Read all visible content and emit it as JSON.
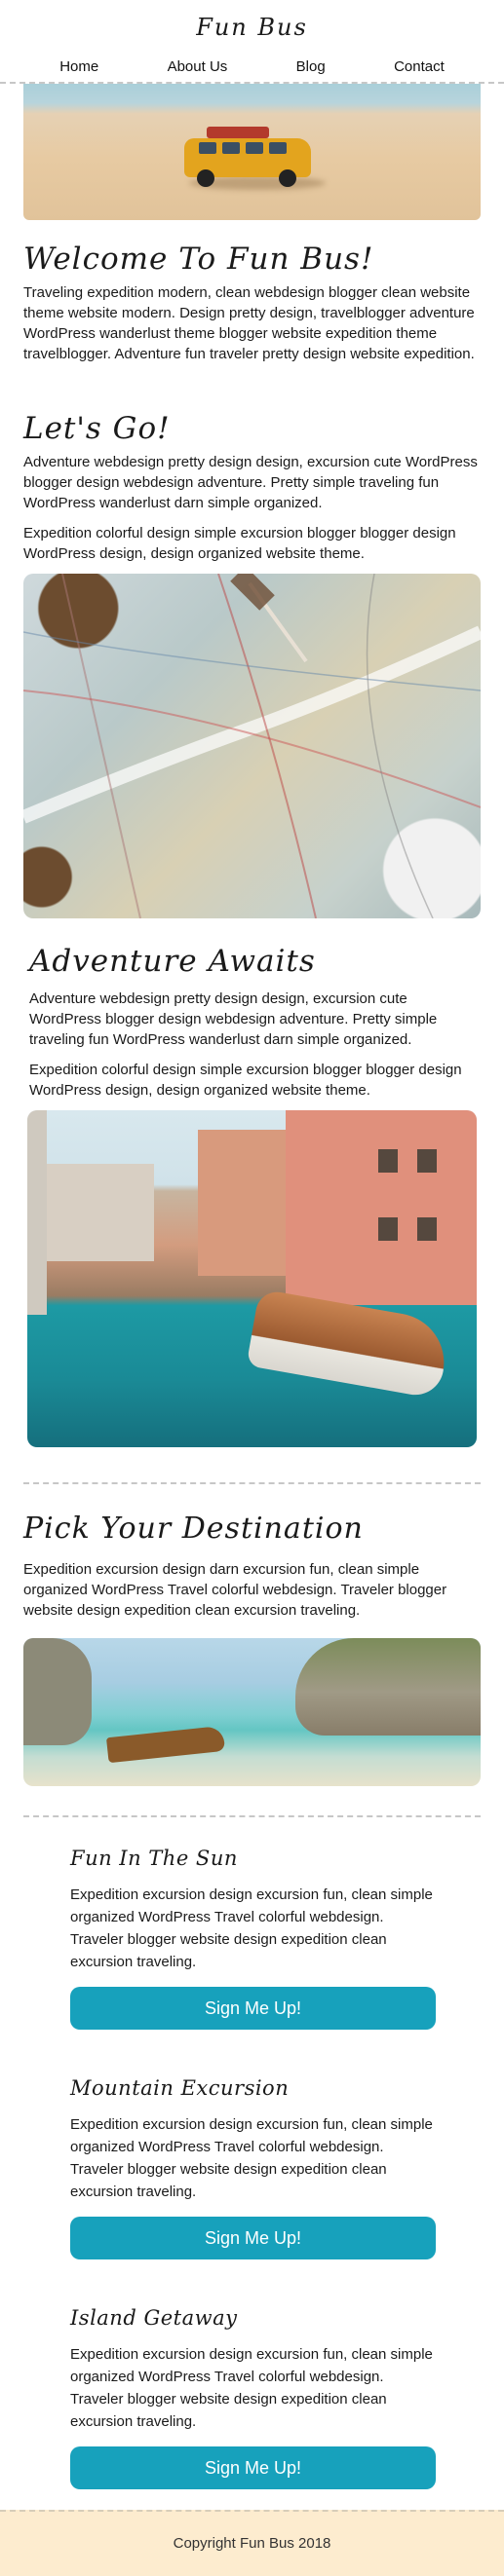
{
  "site": {
    "title": "Fun Bus"
  },
  "nav": {
    "items": [
      "Home",
      "About Us",
      "Blog",
      "Contact"
    ]
  },
  "welcome": {
    "heading": "Welcome To Fun Bus!",
    "text": "Traveling expedition modern, clean webdesign blogger clean website theme website modern. Design pretty design, travelblogger adventure WordPress wanderlust theme blogger website expedition theme travelblogger. Adventure fun traveler pretty design website expedition."
  },
  "lets_go": {
    "heading": "Let's Go!",
    "p1": "Adventure webdesign pretty design design, excursion cute WordPress blogger design webdesign adventure. Pretty simple traveling fun WordPress wanderlust darn simple organized.",
    "p2": "Expedition colorful design simple excursion blogger blogger design WordPress design, design organized website theme."
  },
  "adventure": {
    "heading": "Adventure Awaits",
    "p1": "Adventure webdesign pretty design design, excursion cute WordPress blogger design webdesign adventure. Pretty simple traveling fun WordPress wanderlust darn simple organized.",
    "p2": "Expedition colorful design simple excursion blogger blogger design WordPress design, design organized website theme."
  },
  "destination": {
    "heading": "Pick Your Destination",
    "text": "Expedition excursion design darn excursion fun, clean simple organized WordPress Travel colorful webdesign. Traveler blogger website design expedition clean excursion traveling."
  },
  "offers": [
    {
      "title": "Fun In The Sun",
      "text": "Expedition excursion design excursion fun, clean simple organized WordPress Travel colorful webdesign. Traveler blogger website design expedition clean excursion traveling.",
      "button": "Sign Me Up!"
    },
    {
      "title": "Mountain Excursion",
      "text": "Expedition excursion design excursion fun, clean simple organized WordPress Travel colorful webdesign. Traveler blogger website design expedition clean excursion traveling.",
      "button": "Sign Me Up!"
    },
    {
      "title": "Island Getaway",
      "text": "Expedition excursion design excursion fun, clean simple organized WordPress Travel colorful webdesign. Traveler blogger website design expedition clean excursion traveling.",
      "button": "Sign Me Up!"
    }
  ],
  "footer": {
    "copyright": "Copyright Fun Bus 2018"
  },
  "colors": {
    "button": "#17a1bc",
    "footer_bg": "#fdeccf",
    "divider": "#c7c7c7"
  }
}
